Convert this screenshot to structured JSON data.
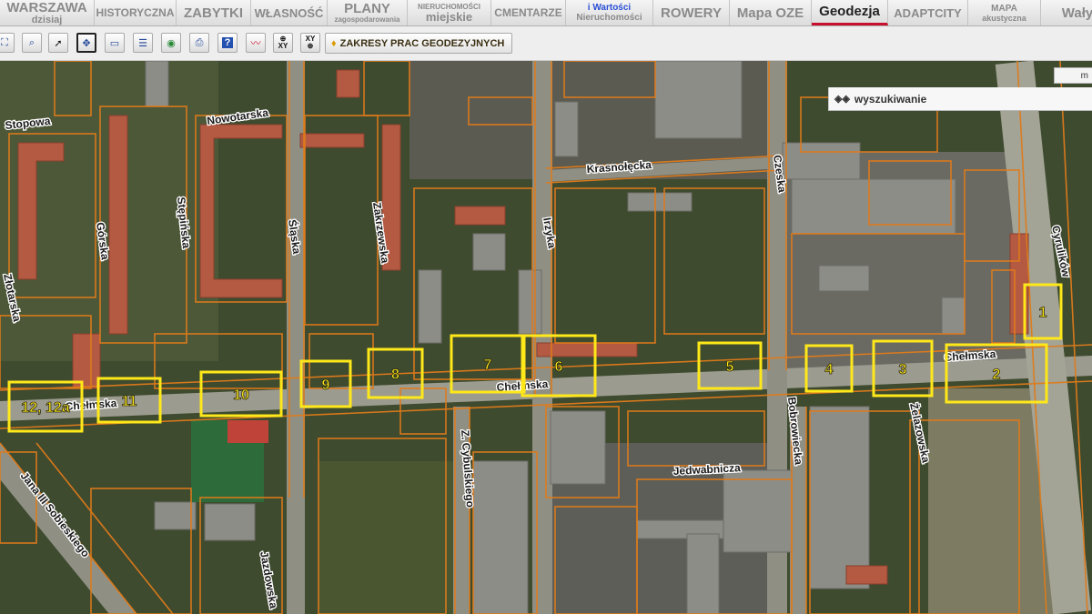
{
  "nav": {
    "tabs": [
      {
        "line1": "WARSZAWA",
        "line2": "dzisiaj"
      },
      {
        "line1": "HISTORYCZNA"
      },
      {
        "line1": "ZABYTKI"
      },
      {
        "line1": "WŁASNOŚĆ"
      },
      {
        "line1": "PLANY",
        "line2": "zagospodarowania"
      },
      {
        "line1": "NIERUCHOMOŚCI",
        "line2": "miejskie"
      },
      {
        "line1": "CMENTARZE"
      },
      {
        "line1": "i Wartości",
        "line2": "Nieruchomości"
      },
      {
        "line1": "ROWERY"
      },
      {
        "line1": "Mapa OZE"
      },
      {
        "line1": "Geodezja"
      },
      {
        "line1": "ADAPTCITY"
      },
      {
        "line1": "MAPA",
        "line2": "akustyczna"
      },
      {
        "line1": "Wały"
      }
    ],
    "active_tab": "Geodezja"
  },
  "toolbar": {
    "tools": [
      {
        "icon": "full-extent-icon"
      },
      {
        "icon": "zoom-window-icon"
      },
      {
        "icon": "pointer-icon"
      },
      {
        "icon": "pan-hand-icon",
        "selected": true
      },
      {
        "icon": "measure-icon"
      },
      {
        "icon": "legend-icon"
      },
      {
        "icon": "globe-icon"
      },
      {
        "icon": "print-icon"
      },
      {
        "icon": "help-icon"
      },
      {
        "icon": "line-draw-icon"
      },
      {
        "icon": "coordinates-xy-icon",
        "label": "XY"
      },
      {
        "icon": "goto-xy-icon",
        "label": "XY"
      }
    ],
    "zakresy_label": "ZAKRESY PRAC GEODEZYJNYCH"
  },
  "search": {
    "label": "wyszukiwanie"
  },
  "map_button": {
    "label": "m"
  },
  "map": {
    "colors": {
      "parcel": "#e07b1a",
      "highlight": "#ffe81a",
      "road": "#9a9a8e",
      "vegetation": "#445a2e",
      "roof": "#8d8d88",
      "red_roof": "#b6553e"
    },
    "streets": [
      "Stopowa",
      "Nowotarska",
      "Krasnołęcka",
      "Czeska",
      "Cyrulików",
      "Złotarska",
      "Górska",
      "Stępińska",
      "Śląska",
      "Zakrzewska",
      "Irzyka",
      "Chełmska",
      "Bobrowiecka",
      "Jedwabnicza",
      "Żelazowska",
      "Jana III Sobieskiego",
      "Z. Cybulskiego",
      "Jazdowska"
    ],
    "labels": {
      "stopowa": "Stopowa",
      "nowotarska": "Nowotarska",
      "krasnolecka": "Krasnołęcka",
      "czeska": "Czeska",
      "cyrulikow": "Cyrulików",
      "zlotarska": "Złotarska",
      "gorska": "Górska",
      "stepinska": "Stępińska",
      "slaska": "Śląska",
      "zakrzewska": "Zakrzewska",
      "irzyka": "Irzyka",
      "chelmska_w": "Chełmska",
      "chelmska_c": "Chełmska",
      "chelmska_e": "Chełmska",
      "bobrowiecka": "Bobrowiecka",
      "jedwabnicza": "Jedwabnicza",
      "zelazowska": "Żelazowska",
      "sobieskiego": "Jana III Sobieskiego",
      "cybulskiego": "Z. Cybulskiego",
      "jazdowska": "Jazdowska"
    },
    "survey_areas": [
      "1",
      "2",
      "3",
      "4",
      "5",
      "6",
      "7",
      "8",
      "9",
      "10",
      "11",
      "12, 12a"
    ]
  }
}
